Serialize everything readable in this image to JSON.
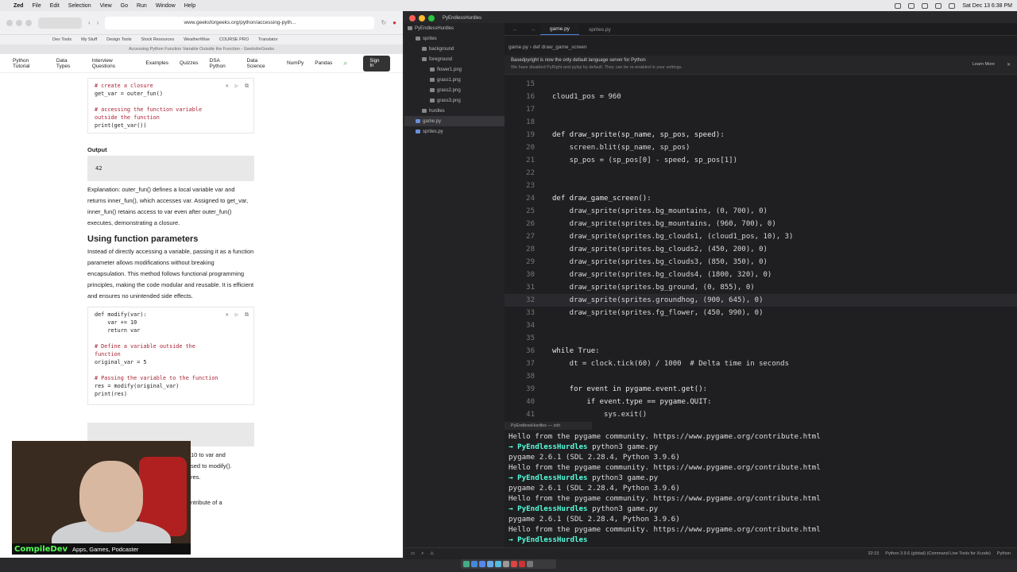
{
  "menubar": {
    "app": "Zed",
    "items": [
      "File",
      "Edit",
      "Selection",
      "View",
      "Go",
      "Run",
      "Window",
      "Help"
    ],
    "clock": "Sat Dec 13  6:38 PM"
  },
  "browser": {
    "url": "www.geeksforgeeks.org/python/accessing-pyth...",
    "tab_title": "Accessing Python Function Variable Outside the Function - GeeksforGeeks",
    "bookmarks": [
      "Dev Tools",
      "My Stuff",
      "Design Tools",
      "Stock Resources",
      "WeatherWise",
      "COURSE PRO",
      "Translator"
    ],
    "nav": [
      "Python Tutorial",
      "Data Types",
      "Interview Questions",
      "Examples",
      "Quizzes",
      "DSA Python",
      "Data Science",
      "NumPy",
      "Pandas"
    ],
    "signin": "Sign In",
    "code1": {
      "c1": "# create a closure",
      "l1": "get_var = outer_fun()",
      "c2": "# accessing the function variable",
      "c2b": "outside the function",
      "l2": "print(get_var())"
    },
    "output_label": "Output",
    "output_value": "42",
    "explanation": "Explanation: outer_fun() defines a local variable var and returns inner_fun(), which accesses var. Assigned to get_var, inner_fun() retains access to var even after outer_fun() executes, demonstrating a closure.",
    "section_title": "Using function parameters",
    "section_text": "Instead of directly accessing a variable, passing it as a function parameter allows modifications without breaking encapsulation. This method follows functional programming principles, making the code modular and reusable. It is efficient and ensures no unintended side effects.",
    "code2": {
      "l1": "def modify(var):",
      "l2": "    var += 10",
      "l3": "    return var",
      "c1": "# Define a variable outside the",
      "c1b": "function",
      "l4": "original_var = 5",
      "c2": "# Passing the variable to the function",
      "l5": "res = modify(original_var)",
      "l6": "print(res)"
    },
    "partial": [
      "10 to var and",
      "sed to modify().",
      "res.",
      "ntribute of a"
    ]
  },
  "webcam": {
    "name": "CompileDev",
    "tagline": "Apps, Games, Podcaster"
  },
  "editor": {
    "title": "PyEndlessHurdles",
    "tree": [
      {
        "label": "PyEndlessHurdles",
        "depth": 0
      },
      {
        "label": "sprites",
        "depth": 1
      },
      {
        "label": "background",
        "depth": 2
      },
      {
        "label": "foreground",
        "depth": 2
      },
      {
        "label": "flower1.png",
        "depth": 3
      },
      {
        "label": "grass1.png",
        "depth": 3
      },
      {
        "label": "grass2.png",
        "depth": 3
      },
      {
        "label": "grass3.png",
        "depth": 3
      },
      {
        "label": "hurdles",
        "depth": 2
      },
      {
        "label": "game.py",
        "depth": 1
      },
      {
        "label": "sprites.py",
        "depth": 1
      }
    ],
    "tabs": [
      "game.py",
      "sprites.py"
    ],
    "breadcrumb": "game.py  ›  def draw_game_screen",
    "notice": "Basedpyright is now the only default language server for Python",
    "notice_sub": "We have disabled PyRight and pylsp by default. They can be re-enabled in your settings.",
    "learn_more": "Learn More",
    "lines": [
      {
        "n": "15",
        "t": ""
      },
      {
        "n": "16",
        "t": "cloud1_pos = 960"
      },
      {
        "n": "17",
        "t": ""
      },
      {
        "n": "18",
        "t": ""
      },
      {
        "n": "19",
        "t": "def draw_sprite(sp_name, sp_pos, speed):"
      },
      {
        "n": "20",
        "t": "    screen.blit(sp_name, sp_pos)"
      },
      {
        "n": "21",
        "t": "    sp_pos = (sp_pos[0] - speed, sp_pos[1])"
      },
      {
        "n": "22",
        "t": ""
      },
      {
        "n": "23",
        "t": ""
      },
      {
        "n": "24",
        "t": "def draw_game_screen():"
      },
      {
        "n": "25",
        "t": "    draw_sprite(sprites.bg_mountains, (0, 700), 0)"
      },
      {
        "n": "26",
        "t": "    draw_sprite(sprites.bg_mountains, (960, 700), 0)"
      },
      {
        "n": "27",
        "t": "    draw_sprite(sprites.bg_clouds1, (cloud1_pos, 10), 3)"
      },
      {
        "n": "28",
        "t": "    draw_sprite(sprites.bg_clouds2, (450, 200), 0)"
      },
      {
        "n": "29",
        "t": "    draw_sprite(sprites.bg_clouds3, (850, 350), 0)"
      },
      {
        "n": "30",
        "t": "    draw_sprite(sprites.bg_clouds4, (1800, 320), 0)"
      },
      {
        "n": "31",
        "t": "    draw_sprite(sprites.bg_ground, (0, 855), 0)"
      },
      {
        "n": "32",
        "t": "    draw_sprite(sprites.groundhog, (900, 645), 0)"
      },
      {
        "n": "33",
        "t": "    draw_sprite(sprites.fg_flower, (450, 990), 0)"
      },
      {
        "n": "34",
        "t": ""
      },
      {
        "n": "35",
        "t": ""
      },
      {
        "n": "36",
        "t": "while True:"
      },
      {
        "n": "37",
        "t": "    dt = clock.tick(60) / 1000  # Delta time in seconds"
      },
      {
        "n": "38",
        "t": ""
      },
      {
        "n": "39",
        "t": "    for event in pygame.event.get():"
      },
      {
        "n": "40",
        "t": "        if event.type == pygame.QUIT:"
      },
      {
        "n": "41",
        "t": "            sys.exit()"
      }
    ],
    "current_line": "32",
    "terminal_title": "PyEndlessHurdles — zsh",
    "terminal": [
      {
        "k": "out",
        "t": "Hello from the pygame community. https://www.pygame.org/contribute.html"
      },
      {
        "k": "cmd",
        "d": "PyEndlessHurdles",
        "t": "python3 game.py"
      },
      {
        "k": "out",
        "t": "pygame 2.6.1 (SDL 2.28.4, Python 3.9.6)"
      },
      {
        "k": "out",
        "t": "Hello from the pygame community. https://www.pygame.org/contribute.html"
      },
      {
        "k": "cmd",
        "d": "PyEndlessHurdles",
        "t": "python3 game.py"
      },
      {
        "k": "out",
        "t": "pygame 2.6.1 (SDL 2.28.4, Python 3.9.6)"
      },
      {
        "k": "out",
        "t": "Hello from the pygame community. https://www.pygame.org/contribute.html"
      },
      {
        "k": "cmd",
        "d": "PyEndlessHurdles",
        "t": "python3 game.py"
      },
      {
        "k": "out",
        "t": "pygame 2.6.1 (SDL 2.28.4, Python 3.9.6)"
      },
      {
        "k": "out",
        "t": "Hello from the pygame community. https://www.pygame.org/contribute.html"
      },
      {
        "k": "cmd",
        "d": "PyEndlessHurdles",
        "t": ""
      }
    ],
    "status": {
      "pos": "32:15",
      "interp": "Python 3.9.6 (global) (Command Line Tools for Xcode)",
      "lang": "Python"
    }
  }
}
